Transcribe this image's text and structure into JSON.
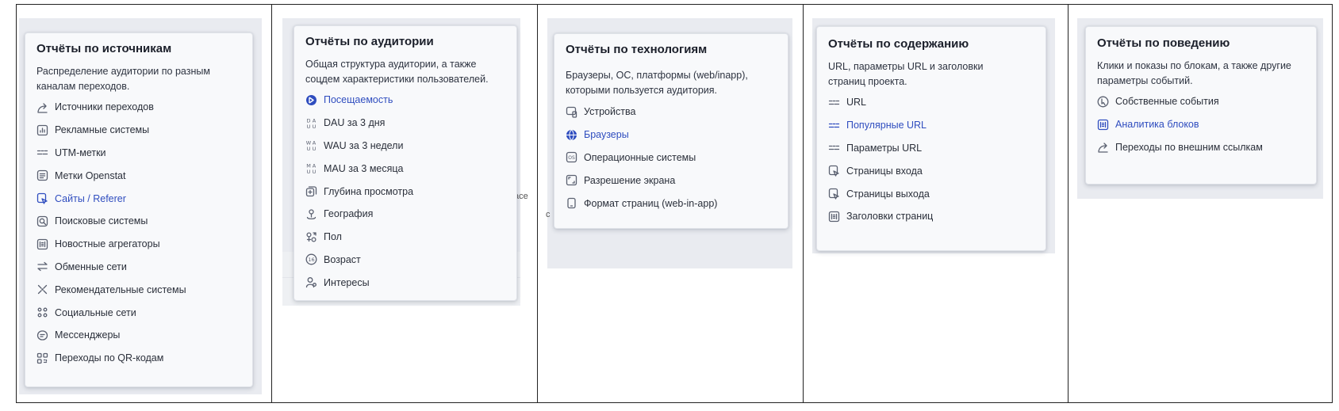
{
  "panels": [
    {
      "title": "Отчёты по источникам",
      "description": "Распределение аудитории по разным каналам переходов.",
      "items": [
        {
          "label": "Источники переходов",
          "icon": "arrow-curve-icon"
        },
        {
          "label": "Рекламные системы",
          "icon": "bar-chart-icon"
        },
        {
          "label": "UTM-метки",
          "icon": "utm-tag-icon"
        },
        {
          "label": "Метки Openstat",
          "icon": "tag-box-icon"
        },
        {
          "label": "Сайты / Referer",
          "icon": "referer-icon",
          "active": true
        },
        {
          "label": "Поисковые системы",
          "icon": "search-icon"
        },
        {
          "label": "Новостные агрегаторы",
          "icon": "news-icon"
        },
        {
          "label": "Обменные сети",
          "icon": "exchange-icon"
        },
        {
          "label": "Рекомендательные системы",
          "icon": "recommend-icon"
        },
        {
          "label": "Социальные сети",
          "icon": "social-icon"
        },
        {
          "label": "Мессенджеры",
          "icon": "message-icon"
        },
        {
          "label": "Переходы по QR-кодам",
          "icon": "qr-icon"
        }
      ]
    },
    {
      "title": "Отчёты по аудитории",
      "description": "Общая структура аудитории, а также соцдем характеристики пользователей.",
      "items": [
        {
          "label": "Посещаемость",
          "icon": "attendance-icon",
          "active": true
        },
        {
          "label": "DAU за 3 дня",
          "icon": "dau-icon"
        },
        {
          "label": "WAU за 3 недели",
          "icon": "wau-icon"
        },
        {
          "label": "MAU за 3 месяца",
          "icon": "mau-icon"
        },
        {
          "label": "Глубина просмотра",
          "icon": "depth-icon"
        },
        {
          "label": "География",
          "icon": "geo-icon"
        },
        {
          "label": "Пол",
          "icon": "gender-icon"
        },
        {
          "label": "Возраст",
          "icon": "age-icon"
        },
        {
          "label": "Интересы",
          "icon": "interests-icon"
        }
      ],
      "age_glyph": "16"
    },
    {
      "title": "Отчёты по технологиям",
      "description": "Браузеры, ОС, платформы (web/inapp), которыми пользуется аудитория.",
      "items": [
        {
          "label": "Устройства",
          "icon": "devices-icon"
        },
        {
          "label": "Браузеры",
          "icon": "globe-icon",
          "active": true
        },
        {
          "label": "Операционные системы",
          "icon": "os-icon"
        },
        {
          "label": "Разрешение экрана",
          "icon": "screen-icon"
        },
        {
          "label": "Формат страниц (web-in-app)",
          "icon": "phone-icon"
        }
      ],
      "os_glyph": "OS"
    },
    {
      "title": "Отчёты по содержанию",
      "description": "URL, параметры URL и заголовки страниц проекта.",
      "items": [
        {
          "label": "URL",
          "icon": "url-icon"
        },
        {
          "label": "Популярные URL",
          "icon": "url-icon",
          "active": true
        },
        {
          "label": "Параметры URL",
          "icon": "url-icon"
        },
        {
          "label": "Страницы входа",
          "icon": "entry-page-icon"
        },
        {
          "label": "Страницы выхода",
          "icon": "exit-page-icon"
        },
        {
          "label": "Заголовки страниц",
          "icon": "headers-icon"
        }
      ]
    },
    {
      "title": "Отчёты по поведению",
      "description": "Клики и показы по блокам, а также другие параметры событий.",
      "items": [
        {
          "label": "Собственные события",
          "icon": "events-icon"
        },
        {
          "label": "Аналитика блоков",
          "icon": "blocks-icon",
          "active": true
        },
        {
          "label": "Переходы по внешним ссылкам",
          "icon": "arrow-curve-icon"
        }
      ]
    }
  ],
  "fragments": {
    "p2": "ace",
    "p3": "c"
  },
  "colors": {
    "accent": "#2f4dbf",
    "text": "#2a2f3a",
    "icon": "#5a6070"
  }
}
